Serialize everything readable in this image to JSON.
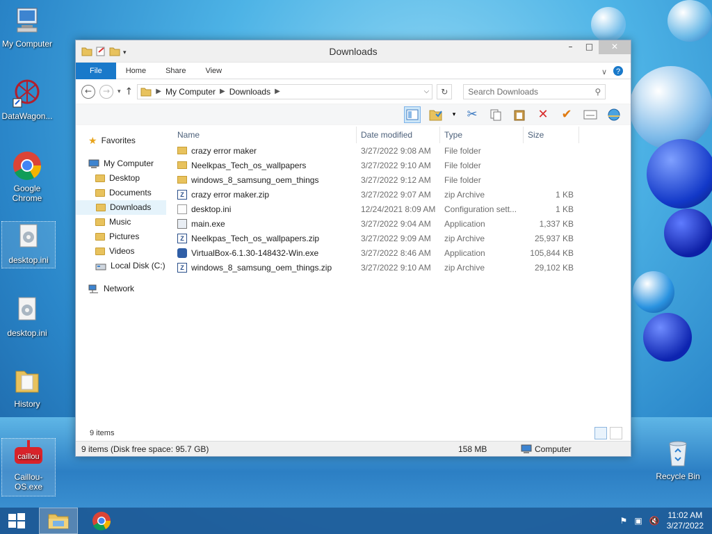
{
  "desktop": {
    "icons": [
      {
        "label": "My Computer"
      },
      {
        "label": "DataWagon..."
      },
      {
        "label": "Google Chrome"
      },
      {
        "label": "desktop.ini"
      },
      {
        "label": "desktop.ini"
      },
      {
        "label": "History"
      },
      {
        "label": "Caillou-OS.exe"
      },
      {
        "label": "Recycle Bin"
      }
    ]
  },
  "window": {
    "title": "Downloads",
    "controls": {
      "minimize": "–",
      "maximize": "□",
      "close": "✕"
    },
    "ribbon_tabs": [
      "File",
      "Home",
      "Share",
      "View"
    ],
    "address": {
      "crumbs": [
        "My Computer",
        "Downloads"
      ],
      "search_placeholder": "Search Downloads"
    },
    "nav": {
      "favorites": "Favorites",
      "my_computer": "My Computer",
      "children": [
        "Desktop",
        "Documents",
        "Downloads",
        "Music",
        "Pictures",
        "Videos",
        "Local Disk (C:)"
      ],
      "selected": "Downloads",
      "network": "Network"
    },
    "columns": {
      "name": "Name",
      "date": "Date modified",
      "type": "Type",
      "size": "Size"
    },
    "files": [
      {
        "name": "crazy error  maker",
        "date": "3/27/2022 9:08 AM",
        "type": "File folder",
        "size": "",
        "icon": "folder-icon"
      },
      {
        "name": "Neelkpas_Tech_os_wallpapers",
        "date": "3/27/2022 9:10 AM",
        "type": "File folder",
        "size": "",
        "icon": "folder-icon"
      },
      {
        "name": "windows_8_samsung_oem_things",
        "date": "3/27/2022 9:12 AM",
        "type": "File folder",
        "size": "",
        "icon": "folder-icon"
      },
      {
        "name": "crazy error  maker.zip",
        "date": "3/27/2022 9:07 AM",
        "type": "zip Archive",
        "size": "1 KB",
        "icon": "zip-icon"
      },
      {
        "name": "desktop.ini",
        "date": "12/24/2021 8:09 AM",
        "type": "Configuration sett...",
        "size": "1 KB",
        "icon": "ini-icon"
      },
      {
        "name": "main.exe",
        "date": "3/27/2022 9:04 AM",
        "type": "Application",
        "size": "1,337 KB",
        "icon": "exe-icon"
      },
      {
        "name": "Neelkpas_Tech_os_wallpapers.zip",
        "date": "3/27/2022 9:09 AM",
        "type": "zip Archive",
        "size": "25,937 KB",
        "icon": "zip-icon"
      },
      {
        "name": "VirtualBox-6.1.30-148432-Win.exe",
        "date": "3/27/2022 8:46 AM",
        "type": "Application",
        "size": "105,844 KB",
        "icon": "virtualbox-icon"
      },
      {
        "name": "windows_8_samsung_oem_things.zip",
        "date": "3/27/2022 9:10 AM",
        "type": "zip Archive",
        "size": "29,102 KB",
        "icon": "zip-icon"
      }
    ],
    "status": {
      "item_count": "9 items",
      "details": "9 items (Disk free space: 95.7 GB)",
      "size": "158 MB",
      "location": "Computer"
    }
  },
  "taskbar": {
    "time": "11:02 AM",
    "date": "3/27/2022"
  },
  "colors": {
    "accent": "#1979ca",
    "selection": "#e5f3fb"
  }
}
